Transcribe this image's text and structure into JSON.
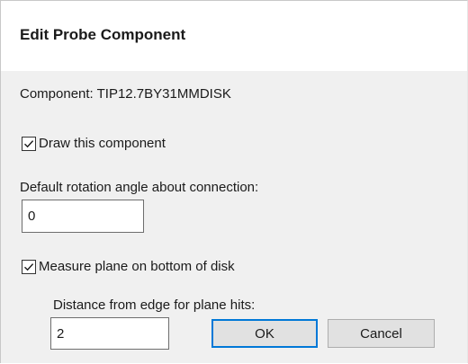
{
  "dialog": {
    "title": "Edit Probe Component",
    "component_label": "Component: TIP12.7BY31MMDISK",
    "draw_component": {
      "label": "Draw this component",
      "checked": true
    },
    "rotation": {
      "label": "Default rotation angle about connection:",
      "value": "0"
    },
    "measure_plane": {
      "label": "Measure plane on bottom of disk",
      "checked": true
    },
    "distance": {
      "label": "Distance from edge for plane hits:",
      "value": "2"
    },
    "ok_label": "OK",
    "cancel_label": "Cancel",
    "colors": {
      "focus_accent": "#0078d7",
      "background": "#f0f0f0"
    },
    "icons": {
      "checkbox": "checkmark-icon"
    }
  }
}
